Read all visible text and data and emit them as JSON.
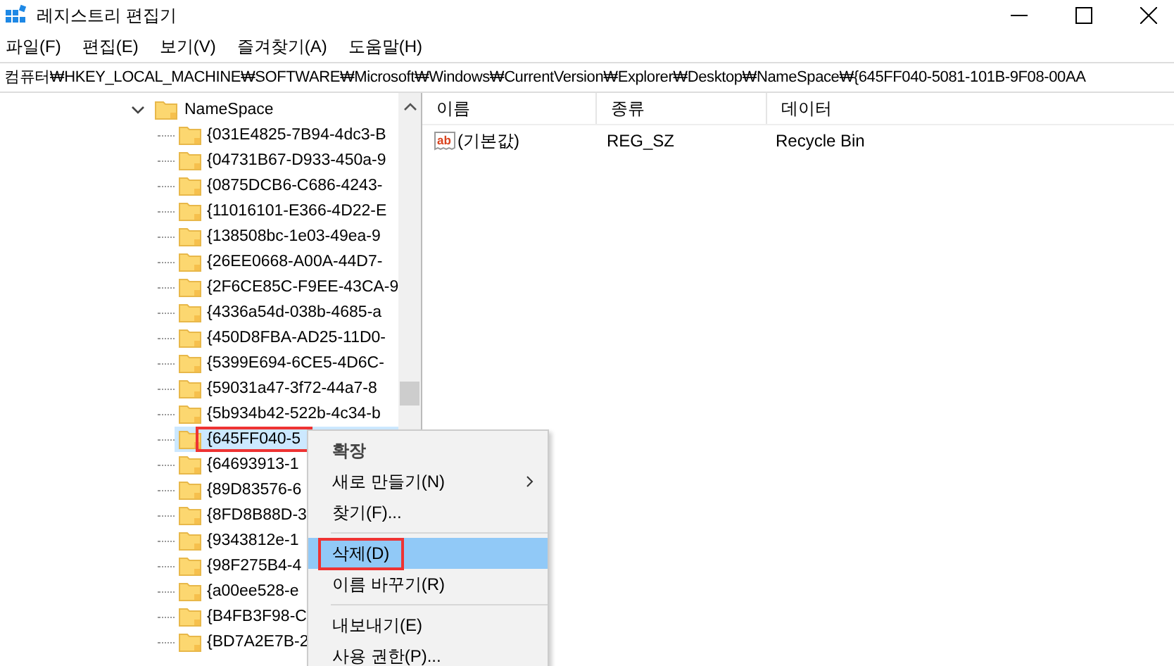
{
  "window": {
    "title": "레지스트리 편집기"
  },
  "menu_bar": [
    "파일(F)",
    "편집(E)",
    "보기(V)",
    "즐겨찾기(A)",
    "도움말(H)"
  ],
  "address_bar": {
    "value": "컴퓨터₩HKEY_LOCAL_MACHINE₩SOFTWARE₩Microsoft₩Windows₩CurrentVersion₩Explorer₩Desktop₩NameSpace₩{645FF040-5081-101B-9F08-00AA"
  },
  "tree": {
    "label": "NameSpace",
    "expanded": true,
    "children": [
      {
        "label": "{031E4825-7B94-4dc3-B",
        "selected": false,
        "annotated": false
      },
      {
        "label": "{04731B67-D933-450a-9",
        "selected": false,
        "annotated": false
      },
      {
        "label": "{0875DCB6-C686-4243-",
        "selected": false,
        "annotated": false
      },
      {
        "label": "{11016101-E366-4D22-E",
        "selected": false,
        "annotated": false
      },
      {
        "label": "{138508bc-1e03-49ea-9",
        "selected": false,
        "annotated": false
      },
      {
        "label": "{26EE0668-A00A-44D7-",
        "selected": false,
        "annotated": false
      },
      {
        "label": "{2F6CE85C-F9EE-43CA-9",
        "selected": false,
        "annotated": false
      },
      {
        "label": "{4336a54d-038b-4685-a",
        "selected": false,
        "annotated": false
      },
      {
        "label": "{450D8FBA-AD25-11D0-",
        "selected": false,
        "annotated": false
      },
      {
        "label": "{5399E694-6CE5-4D6C-",
        "selected": false,
        "annotated": false
      },
      {
        "label": "{59031a47-3f72-44a7-8",
        "selected": false,
        "annotated": false
      },
      {
        "label": "{5b934b42-522b-4c34-b",
        "selected": false,
        "annotated": false
      },
      {
        "label": "{645FF040-5",
        "selected": true,
        "annotated": true
      },
      {
        "label": "{64693913-1",
        "selected": false,
        "annotated": false
      },
      {
        "label": "{89D83576-6",
        "selected": false,
        "annotated": false
      },
      {
        "label": "{8FD8B88D-3",
        "selected": false,
        "annotated": false
      },
      {
        "label": "{9343812e-1",
        "selected": false,
        "annotated": false
      },
      {
        "label": "{98F275B4-4",
        "selected": false,
        "annotated": false
      },
      {
        "label": "{a00ee528-e",
        "selected": false,
        "annotated": false
      },
      {
        "label": "{B4FB3F98-C",
        "selected": false,
        "annotated": false
      },
      {
        "label": "{BD7A2E7B-2",
        "selected": false,
        "annotated": false
      }
    ]
  },
  "values_list": {
    "columns": [
      "이름",
      "종류",
      "데이터"
    ],
    "rows": [
      {
        "icon_label": "ab",
        "name": "(기본값)",
        "type": "REG_SZ",
        "data": "Recycle Bin"
      }
    ]
  },
  "context_menu": {
    "items": [
      {
        "kind": "item",
        "label": "확장",
        "default": true,
        "submenu": false,
        "selected": false,
        "annotated": false
      },
      {
        "kind": "item",
        "label": "새로 만들기(N)",
        "default": false,
        "submenu": true,
        "selected": false,
        "annotated": false
      },
      {
        "kind": "item",
        "label": "찾기(F)...",
        "default": false,
        "submenu": false,
        "selected": false,
        "annotated": false
      },
      {
        "kind": "separator"
      },
      {
        "kind": "item",
        "label": "삭제(D)",
        "default": false,
        "submenu": false,
        "selected": true,
        "annotated": true
      },
      {
        "kind": "item",
        "label": "이름 바꾸기(R)",
        "default": false,
        "submenu": false,
        "selected": false,
        "annotated": false
      },
      {
        "kind": "separator"
      },
      {
        "kind": "item",
        "label": "내보내기(E)",
        "default": false,
        "submenu": false,
        "selected": false,
        "annotated": false
      },
      {
        "kind": "item",
        "label": "사용 권한(P)...",
        "default": false,
        "submenu": false,
        "selected": false,
        "annotated": false
      }
    ]
  }
}
